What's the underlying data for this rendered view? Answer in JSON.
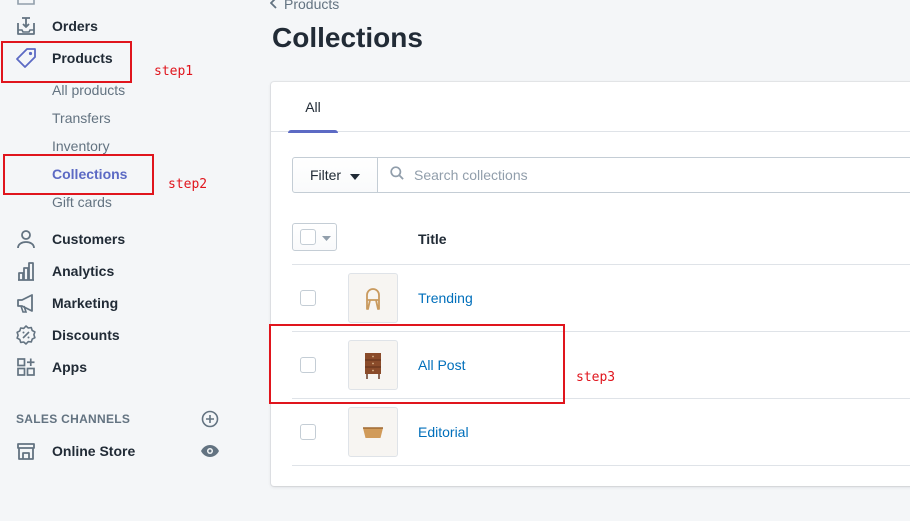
{
  "sidebar": {
    "orders": {
      "label": "Orders",
      "icon": "orders-icon"
    },
    "products": {
      "label": "Products",
      "icon": "tag-icon"
    },
    "product_sub": [
      "All products",
      "Transfers",
      "Inventory",
      "Collections",
      "Gift cards"
    ],
    "customers": {
      "label": "Customers",
      "icon": "customer-icon"
    },
    "analytics": {
      "label": "Analytics",
      "icon": "analytics-icon"
    },
    "marketing": {
      "label": "Marketing",
      "icon": "megaphone-icon"
    },
    "discounts": {
      "label": "Discounts",
      "icon": "discount-icon"
    },
    "apps": {
      "label": "Apps",
      "icon": "apps-icon"
    },
    "sales_channels_heading": "SALES CHANNELS",
    "online_store": {
      "label": "Online Store",
      "icon": "store-icon"
    }
  },
  "breadcrumb": {
    "label": "Products"
  },
  "page": {
    "title": "Collections"
  },
  "tabs": [
    {
      "label": "All",
      "active": true
    }
  ],
  "filter": {
    "label": "Filter"
  },
  "search": {
    "placeholder": "Search collections"
  },
  "table": {
    "columns": [
      "Title"
    ],
    "rows": [
      {
        "title": "Trending",
        "thumbnail": "chair"
      },
      {
        "title": "All Post",
        "thumbnail": "cabinet"
      },
      {
        "title": "Editorial",
        "thumbnail": "bowl"
      }
    ]
  },
  "annotations": {
    "step1": "step1",
    "step2": "step2",
    "step3": "step3"
  },
  "colors": {
    "accent": "#5c6ac4",
    "link": "#006fbb",
    "annotation": "#e0151d",
    "background": "#f4f6f8"
  }
}
